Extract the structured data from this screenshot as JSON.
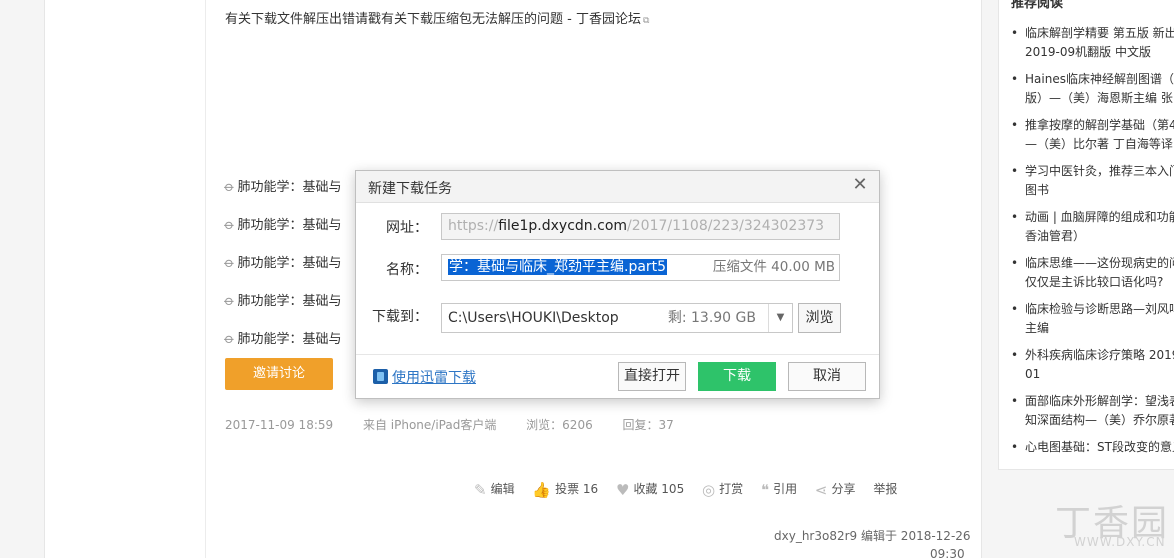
{
  "post": {
    "top_link": "有关下载文件解压出错请戳有关下载压缩包无法解压的问题 - 丁香园论坛",
    "attachments": [
      "肺功能学：基础与",
      "肺功能学：基础与",
      "肺功能学：基础与",
      "肺功能学：基础与",
      "肺功能学：基础与"
    ],
    "invite_button": "邀请讨论",
    "meta": {
      "date": "2017-11-09 18:59",
      "source": "来自 iPhone/iPad客户端",
      "views": "浏览：6206",
      "replies": "回复：37"
    },
    "actions": {
      "edit": "编辑",
      "vote": "投票 16",
      "collect": "收藏 105",
      "tip": "打赏",
      "quote": "引用",
      "share": "分享",
      "report": "举报"
    },
    "edit_note": "dxy_hr3o82r9 编辑于 2018-12-26",
    "edit_time": "09:30"
  },
  "sidebar": {
    "title": "推荐阅读",
    "items": [
      [
        "临床解剖学精要 第五版 新出",
        "2019-09机翻版 中文版"
      ],
      [
        "Haines临床神经解剖图谱（第",
        "版）—（美）海恩斯主编 张"
      ],
      [
        "推拿按摩的解剖学基础（第4",
        "—（美）比尔著 丁自海等译"
      ],
      [
        "学习中医针灸，推荐三本入门",
        "图书"
      ],
      [
        "动画 | 血脑屏障的组成和功能",
        "香油管君）"
      ],
      [
        "临床思维——这份现病史的问",
        "仅仅是主诉比较口语化吗?"
      ],
      [
        "临床检验与诊断思路—刘风鸣",
        "主编"
      ],
      [
        "外科疾病临床诊疗策略 2019",
        "01"
      ],
      [
        "面部临床外形解剖学：望浅表",
        "知深面结构—（美）乔尔原著"
      ],
      [
        "心电图基础：ST段改变的意义"
      ]
    ]
  },
  "watermark": {
    "brand": "丁香园",
    "url": "WWW.DXY.CN"
  },
  "dialog": {
    "title": "新建下载任务",
    "url_label": "网址：",
    "url_prefix": "https://",
    "url_host": "file1p.dxycdn.com",
    "url_path": "/2017/1108/223/324302373",
    "name_label": "名称：",
    "name_value": "学：基础与临床_郑劲平主编.part5",
    "name_size": "压缩文件 40.00 MB",
    "dir_label": "下载到：",
    "dir_value": "C:\\Users\\HOUKI\\Desktop",
    "dir_free": "剩: 13.90 GB",
    "browse_button": "浏览",
    "xunlei_link": "使用迅雷下载",
    "open_button": "直接打开",
    "download_button": "下载",
    "cancel_button": "取消",
    "accent_color": "#2ec36a"
  }
}
